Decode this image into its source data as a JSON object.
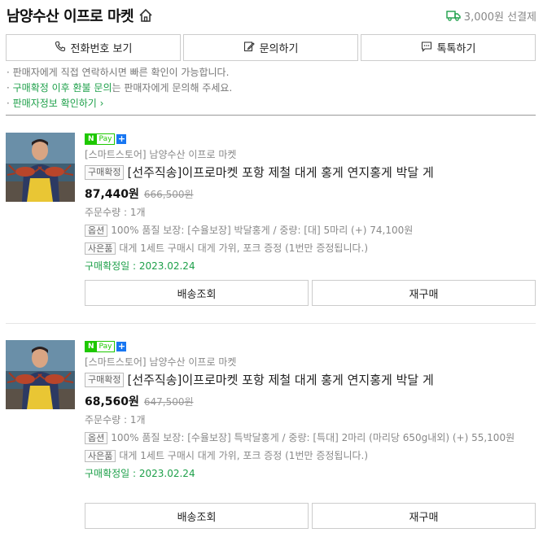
{
  "header": {
    "store_name": "남양수산 이프로 마켓",
    "shipping_text": "3,000원 선결제"
  },
  "actions": [
    {
      "label": "전화번호 보기"
    },
    {
      "label": "문의하기"
    },
    {
      "label": "톡톡하기"
    }
  ],
  "notices": {
    "line1": "판매자에게 직접 연락하시면 빠른 확인이 가능합니다.",
    "line2_highlight": "구매확정 이후 환불 문의",
    "line2_rest": "는 판매자에게 문의해 주세요.",
    "line3_link": "판매자정보 확인하기 ›"
  },
  "badges": {
    "n": "N",
    "pay": "Pay",
    "plus": "+"
  },
  "orders": [
    {
      "seller": "[스마트스토어] 남양수산 이프로 마켓",
      "tag": "구매확정",
      "title": "[선주직송]이프로마켓 포항 제철 대게 홍게 연지홍게 박달 게",
      "price": "87,440원",
      "original_price": "666,500원",
      "quantity": "주문수량 : 1개",
      "option_tag": "옵션",
      "option": "100% 품질 보장: [수율보장] 박달홍게 / 중량: [대] 5마리 (+) 74,100원",
      "gift_tag": "사은품",
      "gift": "대게 1세트 구매시 대게 가위, 포크 증정 (1번만 증정됩니다.)",
      "confirm_date": "구매확정일 : 2023.02.24",
      "btn_track": "배송조회",
      "btn_rebuy": "재구매"
    },
    {
      "seller": "[스마트스토어] 남양수산 이프로 마켓",
      "tag": "구매확정",
      "title": "[선주직송]이프로마켓 포항 제철 대게 홍게 연지홍게 박달 게",
      "price": "68,560원",
      "original_price": "647,500원",
      "quantity": "주문수량 : 1개",
      "option_tag": "옵션",
      "option": "100% 품질 보장: [수율보장] 특박달홍게 / 중량: [특대] 2마리 (마리당 650g내외) (+) 55,100원",
      "gift_tag": "사은품",
      "gift": "대게 1세트 구매시 대게 가위, 포크 증정 (1번만 증정됩니다.)",
      "confirm_date": "구매확정일 : 2023.02.24",
      "btn_track": "배송조회",
      "btn_rebuy": "재구매"
    }
  ],
  "colors": {
    "accent_green": "#1ea04a",
    "npay_green": "#1ec800",
    "plus_blue": "#1877f2"
  }
}
